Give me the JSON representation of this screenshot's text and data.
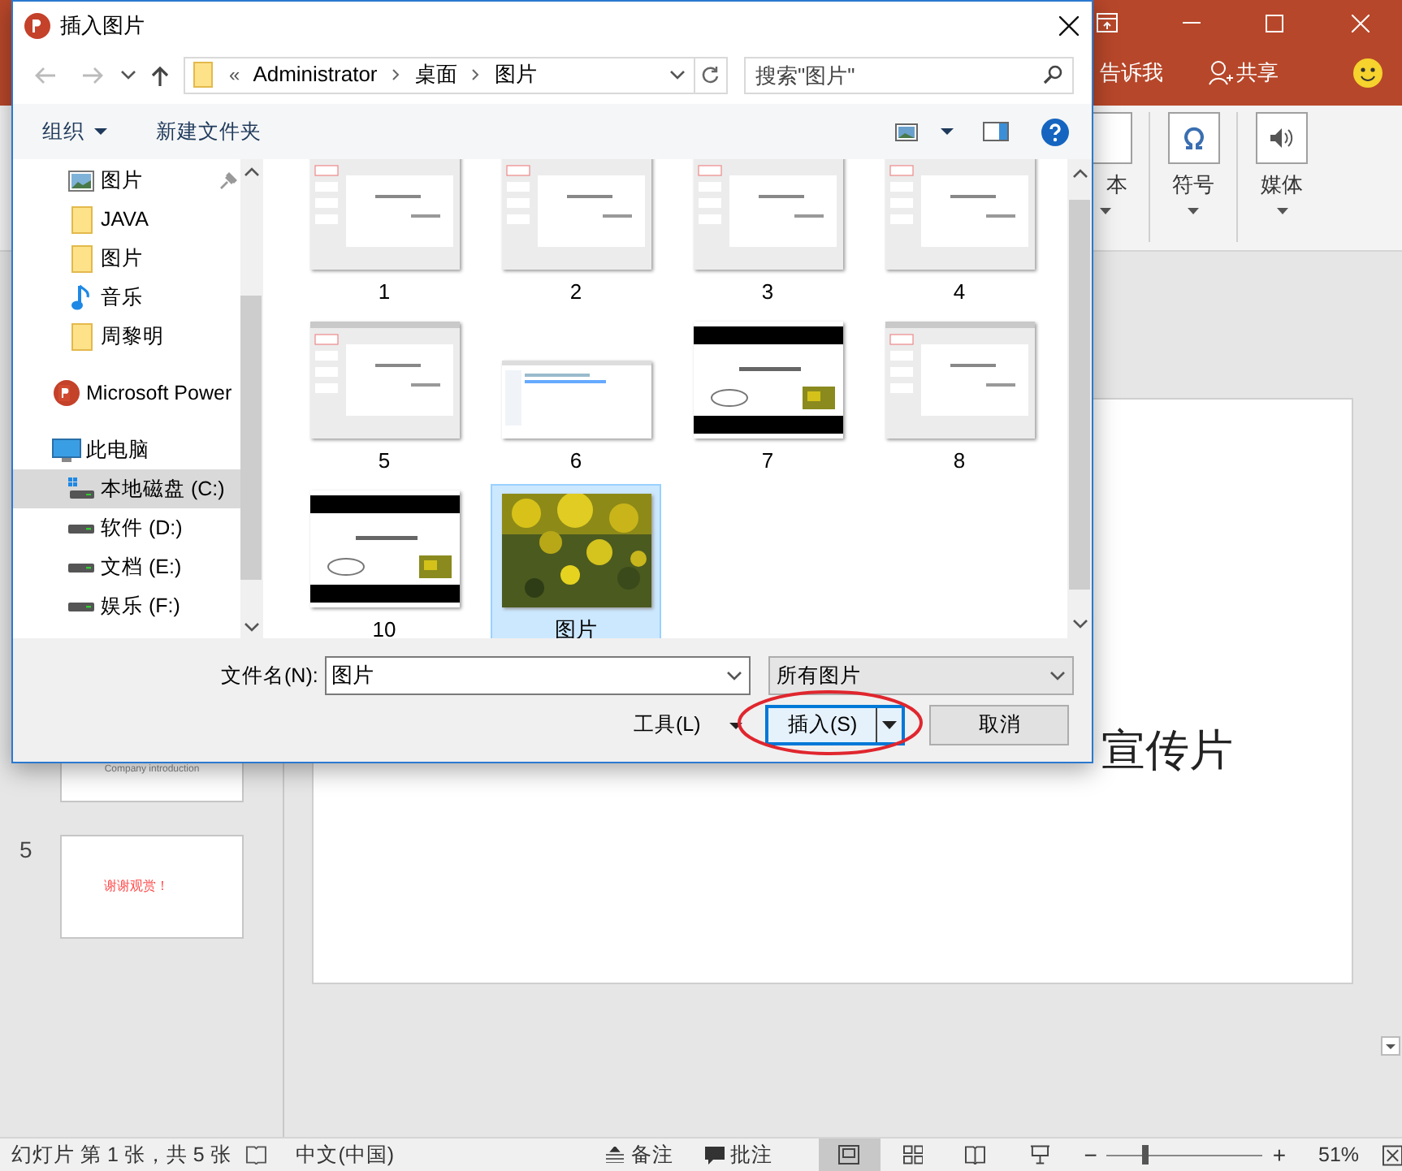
{
  "app": {
    "tell_me": "告诉我",
    "share": "共享"
  },
  "ribbon": {
    "groups": [
      {
        "label": "本",
        "kind": "text"
      },
      {
        "label": "符号",
        "kind": "symbol"
      },
      {
        "label": "媒体",
        "kind": "media"
      }
    ]
  },
  "slides_panel": {
    "slides": [
      {
        "text": "Company introduction"
      },
      {
        "number": "5",
        "text": "谢谢观赏！"
      }
    ]
  },
  "slide": {
    "title": "宣传片"
  },
  "status_bar": {
    "slide_info": "幻灯片 第 1 张，共 5 张",
    "language": "中文(中国)",
    "notes": "备注",
    "comments": "批注",
    "zoom_out": "−",
    "zoom_slider": {
      "level": 0.22
    },
    "zoom_in": "+",
    "zoom": "51%"
  },
  "dialog": {
    "title": "插入图片",
    "overflow": "«",
    "breadcrumb": [
      "Administrator",
      "桌面",
      "图片"
    ],
    "search": {
      "placeholder": "搜索\"图片\""
    },
    "toolbar": {
      "organize": "组织",
      "new_folder": "新建文件夹"
    },
    "nav": [
      {
        "label": "图片",
        "kind": "pictures",
        "pinned": true,
        "selected": false
      },
      {
        "label": "JAVA",
        "kind": "folder",
        "pinned": false,
        "selected": false
      },
      {
        "label": "图片",
        "kind": "folder",
        "pinned": false,
        "selected": false
      },
      {
        "label": "音乐",
        "kind": "music",
        "pinned": false,
        "selected": false
      },
      {
        "label": "周黎明",
        "kind": "folder",
        "pinned": false,
        "selected": false
      },
      {
        "label": "Microsoft Power",
        "kind": "app",
        "pinned": false,
        "selected": false
      },
      {
        "label": "此电脑",
        "kind": "computer",
        "pinned": false,
        "selected": false,
        "children": [
          {
            "label": "本地磁盘 (C:)",
            "kind": "system-drive",
            "pinned": false,
            "selected": true
          },
          {
            "label": "软件 (D:)",
            "kind": "drive",
            "pinned": false,
            "selected": false
          },
          {
            "label": "文档 (E:)",
            "kind": "drive",
            "pinned": false,
            "selected": false
          },
          {
            "label": "娱乐 (F:)",
            "kind": "drive",
            "pinned": false,
            "selected": false
          }
        ]
      }
    ],
    "files": [
      {
        "name": "1",
        "kind": "slide",
        "selected": false
      },
      {
        "name": "2",
        "kind": "slide",
        "selected": false
      },
      {
        "name": "3",
        "kind": "slide",
        "selected": false
      },
      {
        "name": "4",
        "kind": "slide",
        "selected": false
      },
      {
        "name": "5",
        "kind": "slide",
        "selected": false
      },
      {
        "name": "6",
        "kind": "window",
        "selected": false
      },
      {
        "name": "7",
        "kind": "show",
        "selected": false
      },
      {
        "name": "8",
        "kind": "slide",
        "selected": false
      },
      {
        "name": "10",
        "kind": "show",
        "selected": false
      },
      {
        "name": "图片",
        "selected": true
      }
    ],
    "filename_label": "文件名(N):",
    "filename": "图片",
    "filter": "所有图片",
    "tools": "工具(L)",
    "insert": "插入(S)",
    "cancel": "取消"
  }
}
